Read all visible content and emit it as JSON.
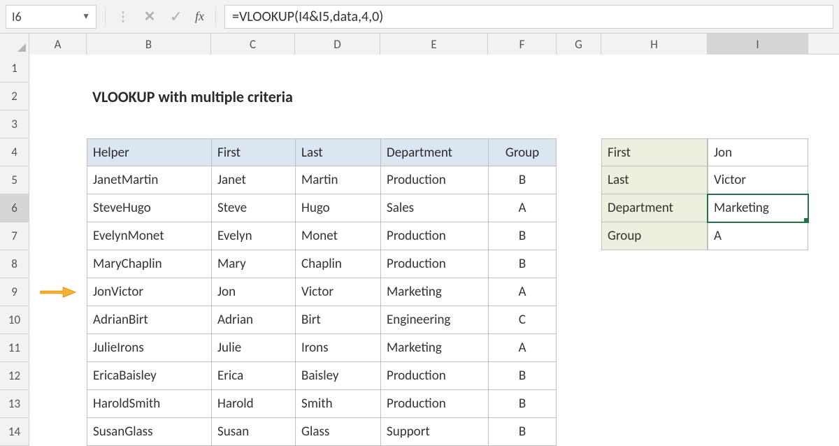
{
  "formula_bar": {
    "cell_ref": "I6",
    "fx_label": "fx",
    "formula": "=VLOOKUP(I4&I5,data,4,0)"
  },
  "columns": [
    "A",
    "B",
    "C",
    "D",
    "E",
    "F",
    "G",
    "H",
    "I"
  ],
  "row_numbers": [
    "1",
    "2",
    "3",
    "4",
    "5",
    "6",
    "7",
    "8",
    "9",
    "10",
    "11",
    "12",
    "13",
    "14"
  ],
  "title": "VLOOKUP with multiple criteria",
  "data_table": {
    "headers": [
      "Helper",
      "First",
      "Last",
      "Department",
      "Group"
    ],
    "rows": [
      [
        "JanetMartin",
        "Janet",
        "Martin",
        "Production",
        "B"
      ],
      [
        "SteveHugo",
        "Steve",
        "Hugo",
        "Sales",
        "A"
      ],
      [
        "EvelynMonet",
        "Evelyn",
        "Monet",
        "Production",
        "B"
      ],
      [
        "MaryChaplin",
        "Mary",
        "Chaplin",
        "Production",
        "B"
      ],
      [
        "JonVictor",
        "Jon",
        "Victor",
        "Marketing",
        "A"
      ],
      [
        "AdrianBirt",
        "Adrian",
        "Birt",
        "Engineering",
        "C"
      ],
      [
        "JulieIrons",
        "Julie",
        "Irons",
        "Marketing",
        "A"
      ],
      [
        "EricaBaisley",
        "Erica",
        "Baisley",
        "Production",
        "B"
      ],
      [
        "HaroldSmith",
        "Harold",
        "Smith",
        "Production",
        "B"
      ],
      [
        "SusanGlass",
        "Susan",
        "Glass",
        "Support",
        "B"
      ]
    ]
  },
  "lookup_panel": {
    "rows": [
      {
        "label": "First",
        "value": "Jon"
      },
      {
        "label": "Last",
        "value": "Victor"
      },
      {
        "label": "Department",
        "value": "Marketing"
      },
      {
        "label": "Group",
        "value": "A"
      }
    ],
    "selected_index": 2
  }
}
